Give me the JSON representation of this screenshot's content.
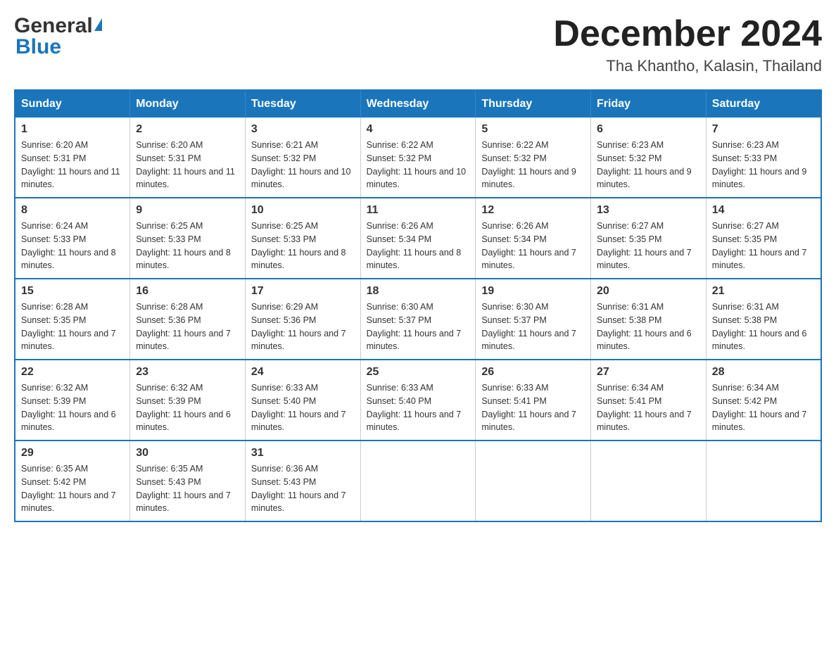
{
  "logo": {
    "text_general": "General",
    "text_blue": "Blue"
  },
  "title": "December 2024",
  "subtitle": "Tha Khantho, Kalasin, Thailand",
  "days_of_week": [
    "Sunday",
    "Monday",
    "Tuesday",
    "Wednesday",
    "Thursday",
    "Friday",
    "Saturday"
  ],
  "weeks": [
    [
      {
        "day": "1",
        "sunrise": "6:20 AM",
        "sunset": "5:31 PM",
        "daylight": "11 hours and 11 minutes."
      },
      {
        "day": "2",
        "sunrise": "6:20 AM",
        "sunset": "5:31 PM",
        "daylight": "11 hours and 11 minutes."
      },
      {
        "day": "3",
        "sunrise": "6:21 AM",
        "sunset": "5:32 PM",
        "daylight": "11 hours and 10 minutes."
      },
      {
        "day": "4",
        "sunrise": "6:22 AM",
        "sunset": "5:32 PM",
        "daylight": "11 hours and 10 minutes."
      },
      {
        "day": "5",
        "sunrise": "6:22 AM",
        "sunset": "5:32 PM",
        "daylight": "11 hours and 9 minutes."
      },
      {
        "day": "6",
        "sunrise": "6:23 AM",
        "sunset": "5:32 PM",
        "daylight": "11 hours and 9 minutes."
      },
      {
        "day": "7",
        "sunrise": "6:23 AM",
        "sunset": "5:33 PM",
        "daylight": "11 hours and 9 minutes."
      }
    ],
    [
      {
        "day": "8",
        "sunrise": "6:24 AM",
        "sunset": "5:33 PM",
        "daylight": "11 hours and 8 minutes."
      },
      {
        "day": "9",
        "sunrise": "6:25 AM",
        "sunset": "5:33 PM",
        "daylight": "11 hours and 8 minutes."
      },
      {
        "day": "10",
        "sunrise": "6:25 AM",
        "sunset": "5:33 PM",
        "daylight": "11 hours and 8 minutes."
      },
      {
        "day": "11",
        "sunrise": "6:26 AM",
        "sunset": "5:34 PM",
        "daylight": "11 hours and 8 minutes."
      },
      {
        "day": "12",
        "sunrise": "6:26 AM",
        "sunset": "5:34 PM",
        "daylight": "11 hours and 7 minutes."
      },
      {
        "day": "13",
        "sunrise": "6:27 AM",
        "sunset": "5:35 PM",
        "daylight": "11 hours and 7 minutes."
      },
      {
        "day": "14",
        "sunrise": "6:27 AM",
        "sunset": "5:35 PM",
        "daylight": "11 hours and 7 minutes."
      }
    ],
    [
      {
        "day": "15",
        "sunrise": "6:28 AM",
        "sunset": "5:35 PM",
        "daylight": "11 hours and 7 minutes."
      },
      {
        "day": "16",
        "sunrise": "6:28 AM",
        "sunset": "5:36 PM",
        "daylight": "11 hours and 7 minutes."
      },
      {
        "day": "17",
        "sunrise": "6:29 AM",
        "sunset": "5:36 PM",
        "daylight": "11 hours and 7 minutes."
      },
      {
        "day": "18",
        "sunrise": "6:30 AM",
        "sunset": "5:37 PM",
        "daylight": "11 hours and 7 minutes."
      },
      {
        "day": "19",
        "sunrise": "6:30 AM",
        "sunset": "5:37 PM",
        "daylight": "11 hours and 7 minutes."
      },
      {
        "day": "20",
        "sunrise": "6:31 AM",
        "sunset": "5:38 PM",
        "daylight": "11 hours and 6 minutes."
      },
      {
        "day": "21",
        "sunrise": "6:31 AM",
        "sunset": "5:38 PM",
        "daylight": "11 hours and 6 minutes."
      }
    ],
    [
      {
        "day": "22",
        "sunrise": "6:32 AM",
        "sunset": "5:39 PM",
        "daylight": "11 hours and 6 minutes."
      },
      {
        "day": "23",
        "sunrise": "6:32 AM",
        "sunset": "5:39 PM",
        "daylight": "11 hours and 6 minutes."
      },
      {
        "day": "24",
        "sunrise": "6:33 AM",
        "sunset": "5:40 PM",
        "daylight": "11 hours and 7 minutes."
      },
      {
        "day": "25",
        "sunrise": "6:33 AM",
        "sunset": "5:40 PM",
        "daylight": "11 hours and 7 minutes."
      },
      {
        "day": "26",
        "sunrise": "6:33 AM",
        "sunset": "5:41 PM",
        "daylight": "11 hours and 7 minutes."
      },
      {
        "day": "27",
        "sunrise": "6:34 AM",
        "sunset": "5:41 PM",
        "daylight": "11 hours and 7 minutes."
      },
      {
        "day": "28",
        "sunrise": "6:34 AM",
        "sunset": "5:42 PM",
        "daylight": "11 hours and 7 minutes."
      }
    ],
    [
      {
        "day": "29",
        "sunrise": "6:35 AM",
        "sunset": "5:42 PM",
        "daylight": "11 hours and 7 minutes."
      },
      {
        "day": "30",
        "sunrise": "6:35 AM",
        "sunset": "5:43 PM",
        "daylight": "11 hours and 7 minutes."
      },
      {
        "day": "31",
        "sunrise": "6:36 AM",
        "sunset": "5:43 PM",
        "daylight": "11 hours and 7 minutes."
      },
      null,
      null,
      null,
      null
    ]
  ]
}
